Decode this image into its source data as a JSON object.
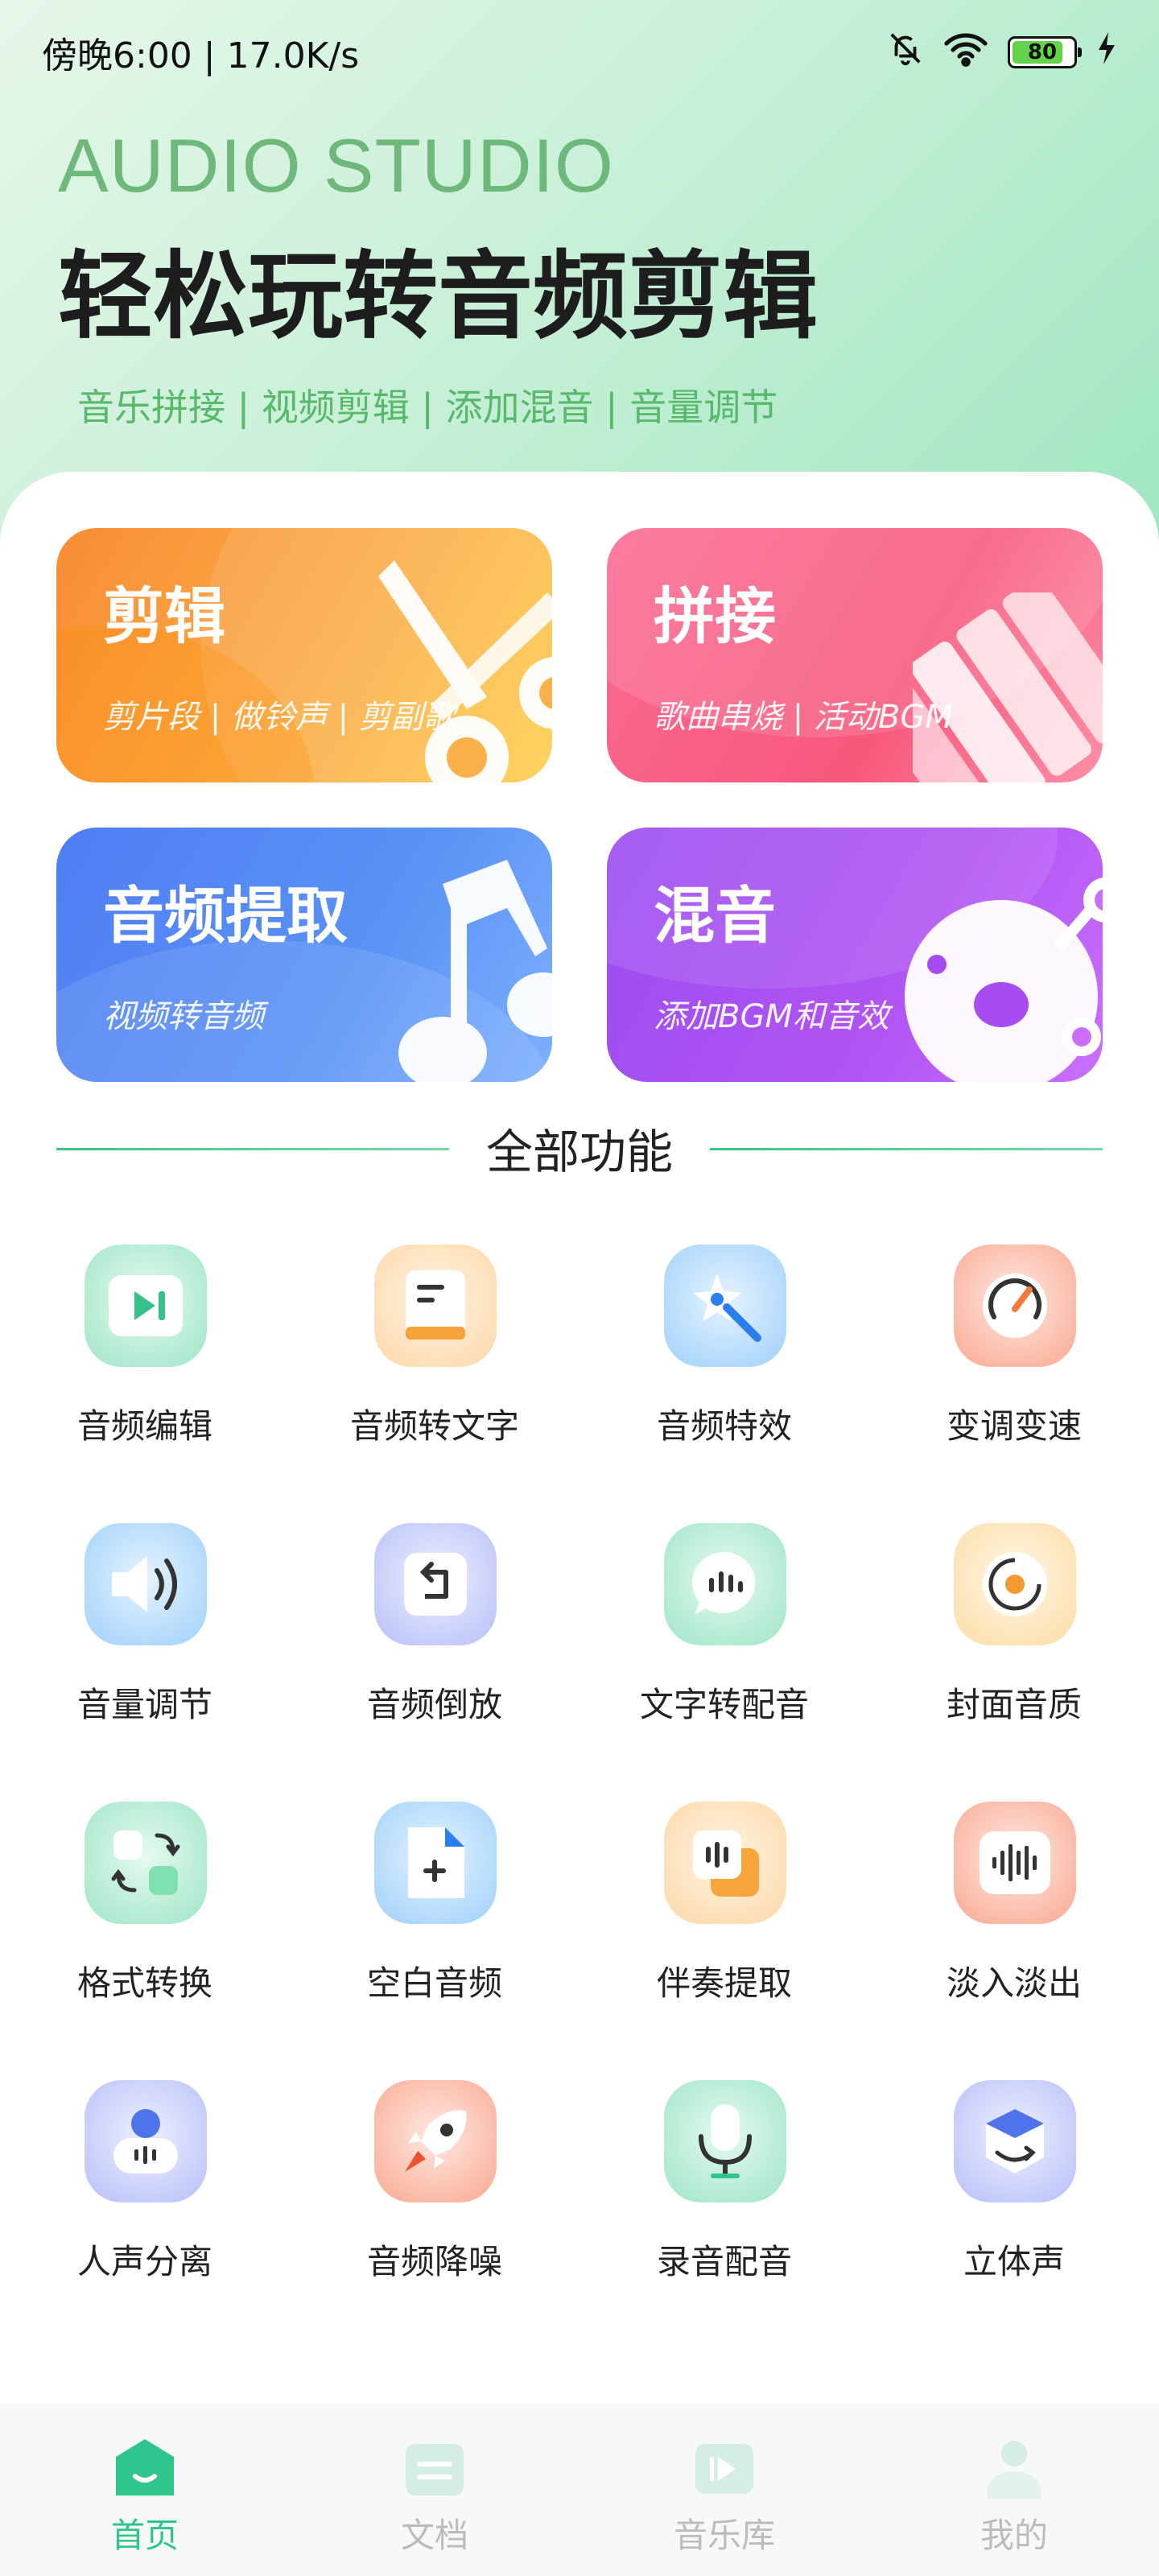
{
  "status_bar": {
    "time_speed": "傍晚6:00 | 17.0K/s",
    "battery": "80"
  },
  "hero": {
    "title_en": "AUDIO STUDIO",
    "title_cn": "轻松玩转音频剪辑",
    "tags": "音乐拼接 | 视频剪辑 | 添加混音 | 音量调节"
  },
  "cards": [
    {
      "title": "剪辑",
      "subtitle": "剪片段 | 做铃声 | 剪副歌",
      "icon": "scissors-icon"
    },
    {
      "title": "拼接",
      "subtitle": "歌曲串烧 | 活动BGM",
      "icon": "piano-keys-icon"
    },
    {
      "title": "音频提取",
      "subtitle": "视频转音频",
      "icon": "music-note-icon"
    },
    {
      "title": "混音",
      "subtitle": "添加BGM和音效",
      "icon": "mixer-icon"
    }
  ],
  "section": {
    "title": "全部功能"
  },
  "tools": [
    {
      "label": "音频编辑",
      "icon": "play-edit-icon"
    },
    {
      "label": "音频转文字",
      "icon": "document-icon"
    },
    {
      "label": "音频特效",
      "icon": "magic-wand-icon"
    },
    {
      "label": "变调变速",
      "icon": "speedometer-icon"
    },
    {
      "label": "音量调节",
      "icon": "volume-icon"
    },
    {
      "label": "音频倒放",
      "icon": "reverse-icon"
    },
    {
      "label": "文字转配音",
      "icon": "speech-bubble-icon"
    },
    {
      "label": "封面音质",
      "icon": "disc-icon"
    },
    {
      "label": "格式转换",
      "icon": "format-convert-icon"
    },
    {
      "label": "空白音频",
      "icon": "blank-file-icon"
    },
    {
      "label": "伴奏提取",
      "icon": "accompaniment-icon"
    },
    {
      "label": "淡入淡出",
      "icon": "waveform-icon"
    },
    {
      "label": "人声分离",
      "icon": "voice-separate-icon"
    },
    {
      "label": "音频降噪",
      "icon": "rocket-icon"
    },
    {
      "label": "录音配音",
      "icon": "microphone-icon"
    },
    {
      "label": "立体声",
      "icon": "stereo-cube-icon"
    }
  ],
  "bottom_nav": [
    {
      "label": "首页",
      "icon": "home-icon",
      "active": true
    },
    {
      "label": "文档",
      "icon": "documents-icon",
      "active": false
    },
    {
      "label": "音乐库",
      "icon": "music-library-icon",
      "active": false
    },
    {
      "label": "我的",
      "icon": "profile-icon",
      "active": false
    }
  ],
  "colors": {
    "accent": "#2fc58c",
    "hero_en": "#6fb87c",
    "tags": "#58b86c",
    "nav_inactive": "#bcbcbc"
  }
}
